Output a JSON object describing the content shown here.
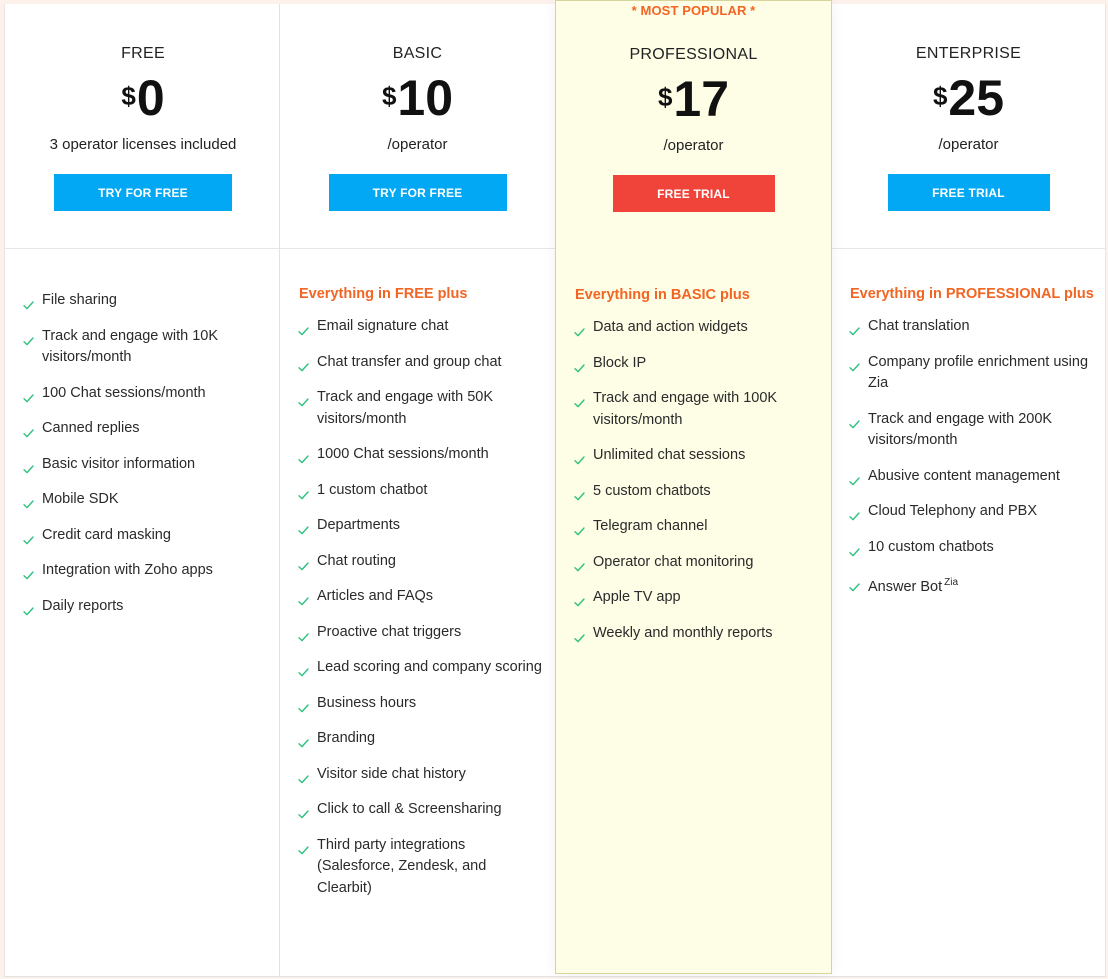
{
  "colors": {
    "accent_blue": "#02a8f3",
    "accent_red": "#f0443a",
    "orange_heading": "#f26522",
    "check_green": "#2ec27e",
    "highlight_bg": "#fefde6"
  },
  "popular_badge": "* MOST POPULAR *",
  "plans": [
    {
      "name": "FREE",
      "currency": "$",
      "price": "0",
      "price_note": "3 operator licenses included",
      "cta": "TRY FOR FREE",
      "section_title": "",
      "features": [
        "File sharing",
        "Track and engage with 10K visitors/month",
        "100 Chat sessions/month",
        "Canned replies",
        "Basic visitor information",
        "Mobile SDK",
        "Credit card masking",
        "Integration with Zoho apps",
        "Daily reports"
      ]
    },
    {
      "name": "BASIC",
      "currency": "$",
      "price": "10",
      "price_note": "/operator",
      "cta": "TRY FOR FREE",
      "section_title": "Everything in FREE plus",
      "features": [
        "Email signature chat",
        "Chat transfer and group chat",
        "Track and engage with 50K visitors/month",
        "1000 Chat sessions/month",
        "1 custom chatbot",
        "Departments",
        "Chat routing",
        "Articles and FAQs",
        "Proactive chat triggers",
        "Lead scoring and company scoring",
        "Business hours",
        "Branding",
        "Visitor side chat history",
        "Click to call & Screensharing",
        "Third party integrations (Salesforce, Zendesk, and Clearbit)"
      ]
    },
    {
      "name": "PROFESSIONAL",
      "currency": "$",
      "price": "17",
      "price_note": "/operator",
      "cta": "FREE TRIAL",
      "section_title": "Everything in BASIC plus",
      "features": [
        "Data and action widgets",
        "Block IP",
        "Track and engage with 100K visitors/month",
        "Unlimited chat sessions",
        "5 custom chatbots",
        "Telegram channel",
        "Operator chat monitoring",
        "Apple TV app",
        "Weekly and monthly reports"
      ]
    },
    {
      "name": "ENTERPRISE",
      "currency": "$",
      "price": "25",
      "price_note": "/operator",
      "cta": "FREE TRIAL",
      "section_title": "Everything in PROFESSIONAL plus",
      "features": [
        "Chat translation",
        "Company profile enrichment using Zia",
        "Track and engage with 200K visitors/month",
        "Abusive content management",
        "Cloud Telephony and PBX",
        "10 custom chatbots",
        "Answer Bot"
      ],
      "last_feature_superscript": "Zia"
    }
  ]
}
